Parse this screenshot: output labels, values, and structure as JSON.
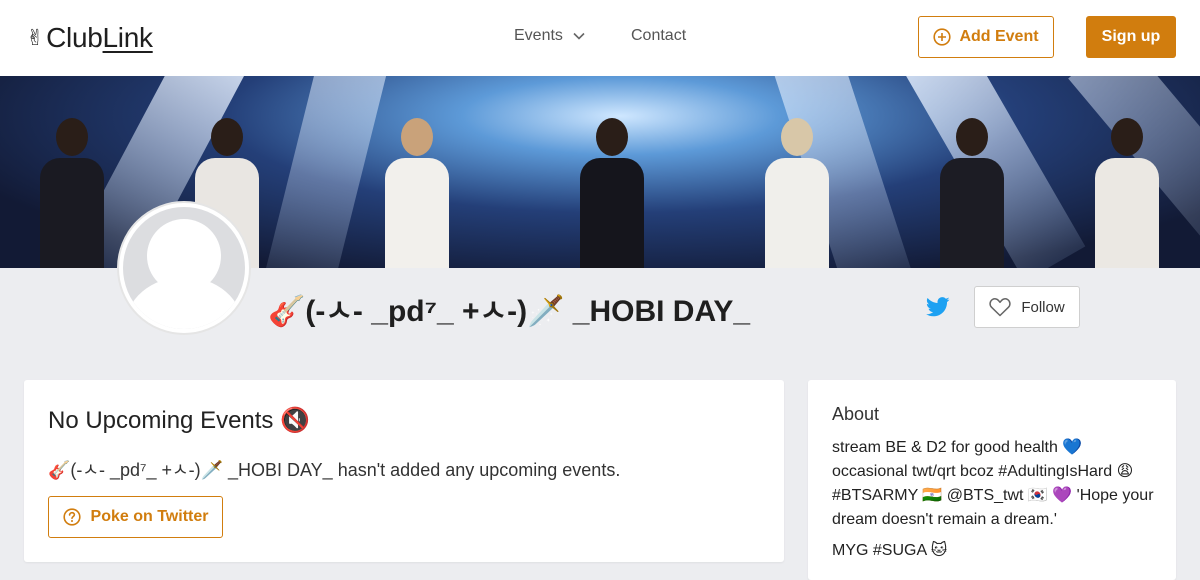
{
  "header": {
    "logo_icon": "✌",
    "logo_text_a": "Club",
    "logo_text_b": "Link",
    "nav_events": "Events",
    "nav_contact": "Contact",
    "add_event": "Add Event",
    "sign_up": "Sign up"
  },
  "profile": {
    "name": "🎸(-ㅅ- _pd⁷_ +ㅅ-)🗡️ _HOBI DAY_",
    "follow": "Follow",
    "social_icon": "twitter-icon"
  },
  "events": {
    "title": "No Upcoming Events 🔇",
    "message": "🎸(-ㅅ- _pd⁷_ +ㅅ-)🗡️ _HOBI DAY_ hasn't added any upcoming events.",
    "poke_button": "Poke on Twitter"
  },
  "about": {
    "title": "About",
    "bio": "stream BE & D2 for good health 💙 occasional twt/qrt bcoz #AdultingIsHard 😩 #BTSARMY 🇮🇳 @BTS_twt 🇰🇷 💜 'Hope your dream doesn't remain a dream.'",
    "bio_line2": "MYG #SUGA 🐱"
  },
  "colors": {
    "accent": "#d17d0e",
    "background": "#ecedf0",
    "twitter": "#1da1f2"
  }
}
